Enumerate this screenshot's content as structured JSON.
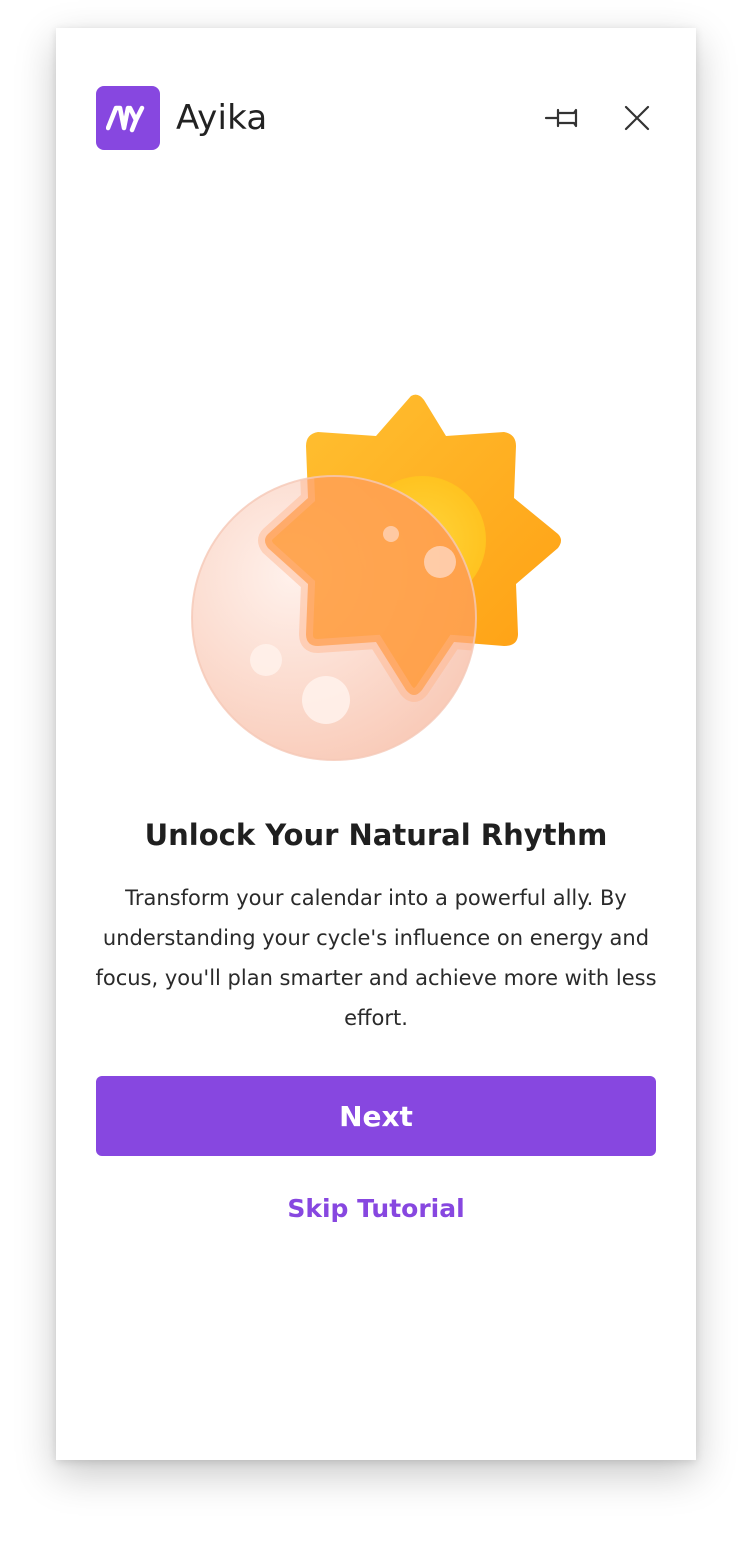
{
  "header": {
    "app_name": "Ayika",
    "logo_text": "Ay"
  },
  "icons": {
    "pin": "pin-icon",
    "close": "close-icon",
    "hero": "sun-moon-illustration"
  },
  "onboarding": {
    "title": "Unlock Your Natural Rhythm",
    "description": "Transform your calendar into a powerful ally. By understanding your cycle's influence on energy and focus, you'll plan smarter and achieve more with less effort.",
    "primary_button": "Next",
    "secondary_link": "Skip Tutorial"
  },
  "colors": {
    "accent": "#8747E0",
    "sun": "#FFB21A",
    "moon": "#FBD2C2"
  }
}
